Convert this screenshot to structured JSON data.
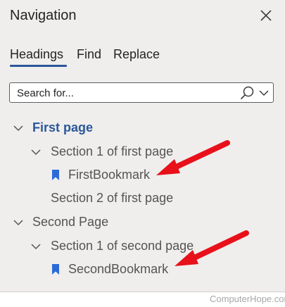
{
  "pane": {
    "title": "Navigation",
    "close_icon": "close-icon"
  },
  "tabs": [
    {
      "label": "Headings",
      "active": true
    },
    {
      "label": "Find",
      "active": false
    },
    {
      "label": "Replace",
      "active": false
    }
  ],
  "search": {
    "placeholder": "Search for...",
    "value": "",
    "search_icon": "search-icon",
    "dropdown_icon": "chevron-down-icon"
  },
  "tree": [
    {
      "label": "First page",
      "level": 1,
      "expanded": true,
      "selected": true
    },
    {
      "label": "Section 1 of first page",
      "level": 2,
      "expanded": true
    },
    {
      "label": "FirstBookmark",
      "level": 3,
      "icon": "bookmark-icon"
    },
    {
      "label": "Section 2 of first page",
      "level": 2
    },
    {
      "label": "Second Page",
      "level": 1,
      "expanded": true
    },
    {
      "label": "Section 1 of second page",
      "level": 2,
      "expanded": true
    },
    {
      "label": "SecondBookmark",
      "level": 3,
      "icon": "bookmark-icon"
    }
  ],
  "colors": {
    "accent": "#2b579a",
    "bookmark": "#2b6bd6",
    "annotation_arrow": "#e8101a"
  },
  "watermark": "ComputerHope.com"
}
